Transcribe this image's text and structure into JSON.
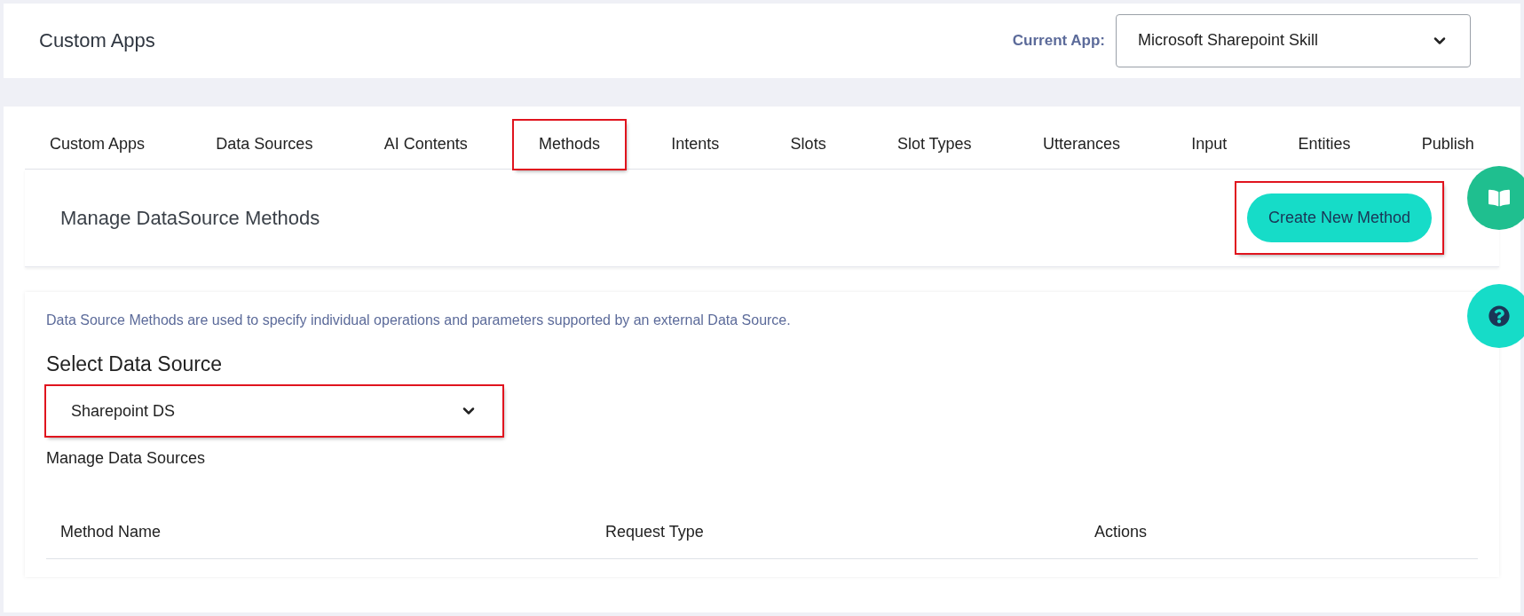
{
  "header": {
    "title": "Custom Apps",
    "current_app_label": "Current App:",
    "current_app": "Microsoft Sharepoint Skill"
  },
  "tabs": [
    {
      "label": "Custom Apps",
      "highlighted": false
    },
    {
      "label": "Data Sources",
      "highlighted": false
    },
    {
      "label": "AI Contents",
      "highlighted": false
    },
    {
      "label": "Methods",
      "highlighted": true
    },
    {
      "label": "Intents",
      "highlighted": false
    },
    {
      "label": "Slots",
      "highlighted": false
    },
    {
      "label": "Slot Types",
      "highlighted": false
    },
    {
      "label": "Utterances",
      "highlighted": false
    },
    {
      "label": "Input",
      "highlighted": false
    },
    {
      "label": "Entities",
      "highlighted": false
    },
    {
      "label": "Publish",
      "highlighted": false
    }
  ],
  "section": {
    "title": "Manage DataSource Methods",
    "button": {
      "label": "Create New Method",
      "highlighted": true
    }
  },
  "description": "Data Source Methods are used to specify individual operations and parameters supported by an external Data Source.",
  "select_data_source": {
    "label": "Select Data Source",
    "value": "Sharepoint DS",
    "highlighted": true
  },
  "manage_link": "Manage Data Sources",
  "table": {
    "columns": [
      "Method Name",
      "Request Type",
      "Actions"
    ]
  }
}
